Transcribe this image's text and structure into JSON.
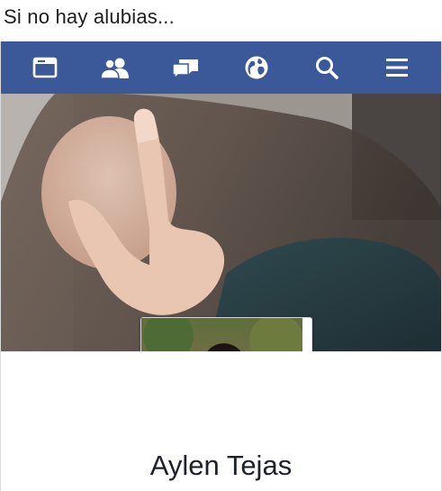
{
  "caption": "Si no hay alubias...",
  "navbar": {
    "background_color": "#3b5998",
    "icon_color": "#ffffff",
    "items": [
      {
        "name": "news-feed",
        "icon": "news-feed-icon"
      },
      {
        "name": "friends",
        "icon": "friends-icon"
      },
      {
        "name": "messages",
        "icon": "messages-icon"
      },
      {
        "name": "notifications",
        "icon": "globe-icon"
      },
      {
        "name": "search",
        "icon": "search-icon"
      },
      {
        "name": "menu",
        "icon": "hamburger-menu-icon"
      }
    ]
  },
  "profile": {
    "name": "Aylen Tejas",
    "cover_photo": "cover-photo",
    "profile_photo": "profile-photo"
  }
}
